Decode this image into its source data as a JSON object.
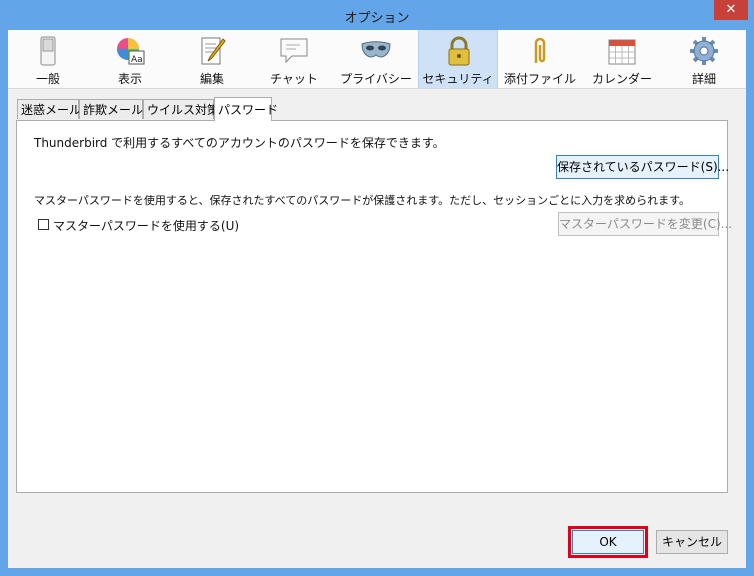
{
  "window": {
    "title": "オプション",
    "close_glyph": "✕"
  },
  "toolbar": {
    "items": [
      {
        "label": "一般",
        "icon": "switch-icon"
      },
      {
        "label": "表示",
        "icon": "color-wheel-icon"
      },
      {
        "label": "編集",
        "icon": "document-pen-icon"
      },
      {
        "label": "チャット",
        "icon": "chat-bubble-icon"
      },
      {
        "label": "プライバシー",
        "icon": "mask-icon"
      },
      {
        "label": "セキュリティ",
        "icon": "padlock-icon"
      },
      {
        "label": "添付ファイル",
        "icon": "paperclip-icon"
      },
      {
        "label": "カレンダー",
        "icon": "calendar-icon"
      },
      {
        "label": "詳細",
        "icon": "gear-icon"
      }
    ],
    "selected": "セキュリティ"
  },
  "tabs": [
    {
      "label": "迷惑メール"
    },
    {
      "label": "詐欺メール"
    },
    {
      "label": "ウイルス対策"
    },
    {
      "label": "パスワード"
    }
  ],
  "password": {
    "description": "Thunderbird で利用するすべてのアカウントのパスワードを保存できます。",
    "saved_button": "保存されているパスワード(S)...",
    "master_description": "マスターパスワードを使用すると、保存されたすべてのパスワードが保護されます。ただし、セッションごとに入力を求められます。",
    "master_checkbox_label": "マスターパスワードを使用する(U)",
    "master_checkbox_checked": false,
    "change_master_button": "マスターパスワードを変更(C)..."
  },
  "footer": {
    "ok_label": "OK",
    "cancel_label": "キャンセル"
  },
  "colors": {
    "highlight": "#e0001b",
    "window_frame": "#62a5e8",
    "selected_toolbar": "#cfe2f5"
  }
}
